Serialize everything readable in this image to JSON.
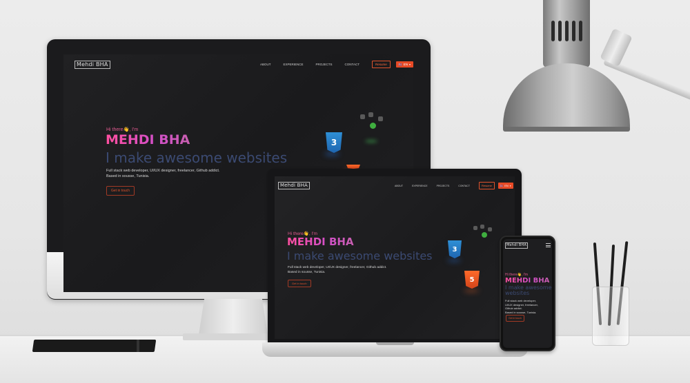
{
  "site": {
    "logo": "Mehdi BHA",
    "nav": [
      "ABOUT",
      "EXPERIENCE",
      "PROJECTS",
      "CONTACT"
    ],
    "resume_label": "Resume",
    "lang_flag": "🇬🇧",
    "lang_label": "EN",
    "lang_icon": "chevron-down-icon",
    "greeting": "Hi there👋, I'm",
    "name": "MEHDI BHA",
    "tagline": "I make awesome websites",
    "tagline_line1": "I make awesome",
    "tagline_line2": "websites",
    "description_line1": "Full stack web developer, UI/UX designer, freelancer, Github addict.",
    "description_line2": "Based in sousse, Tunisia.",
    "phone_description_line1": "Full stack web developer,",
    "phone_description_line2": "UI/UX designer, freelancer,",
    "phone_description_line3": "Github addict.",
    "phone_description_line4": "Based in sousse, Tunisia.",
    "cta_label": "Get in touch",
    "badges": [
      {
        "icon": "css3-badge-icon",
        "glyph": "3"
      },
      {
        "icon": "html5-badge-icon",
        "glyph": "5"
      },
      {
        "icon": "nodejs-icon"
      }
    ],
    "menu_icon": "hamburger-menu-icon"
  },
  "colors": {
    "accent_orange": "#e84a26",
    "name_pink": "#ff4fa0",
    "tagline_blue": "#3b4a72",
    "background": "#1e1e20"
  }
}
